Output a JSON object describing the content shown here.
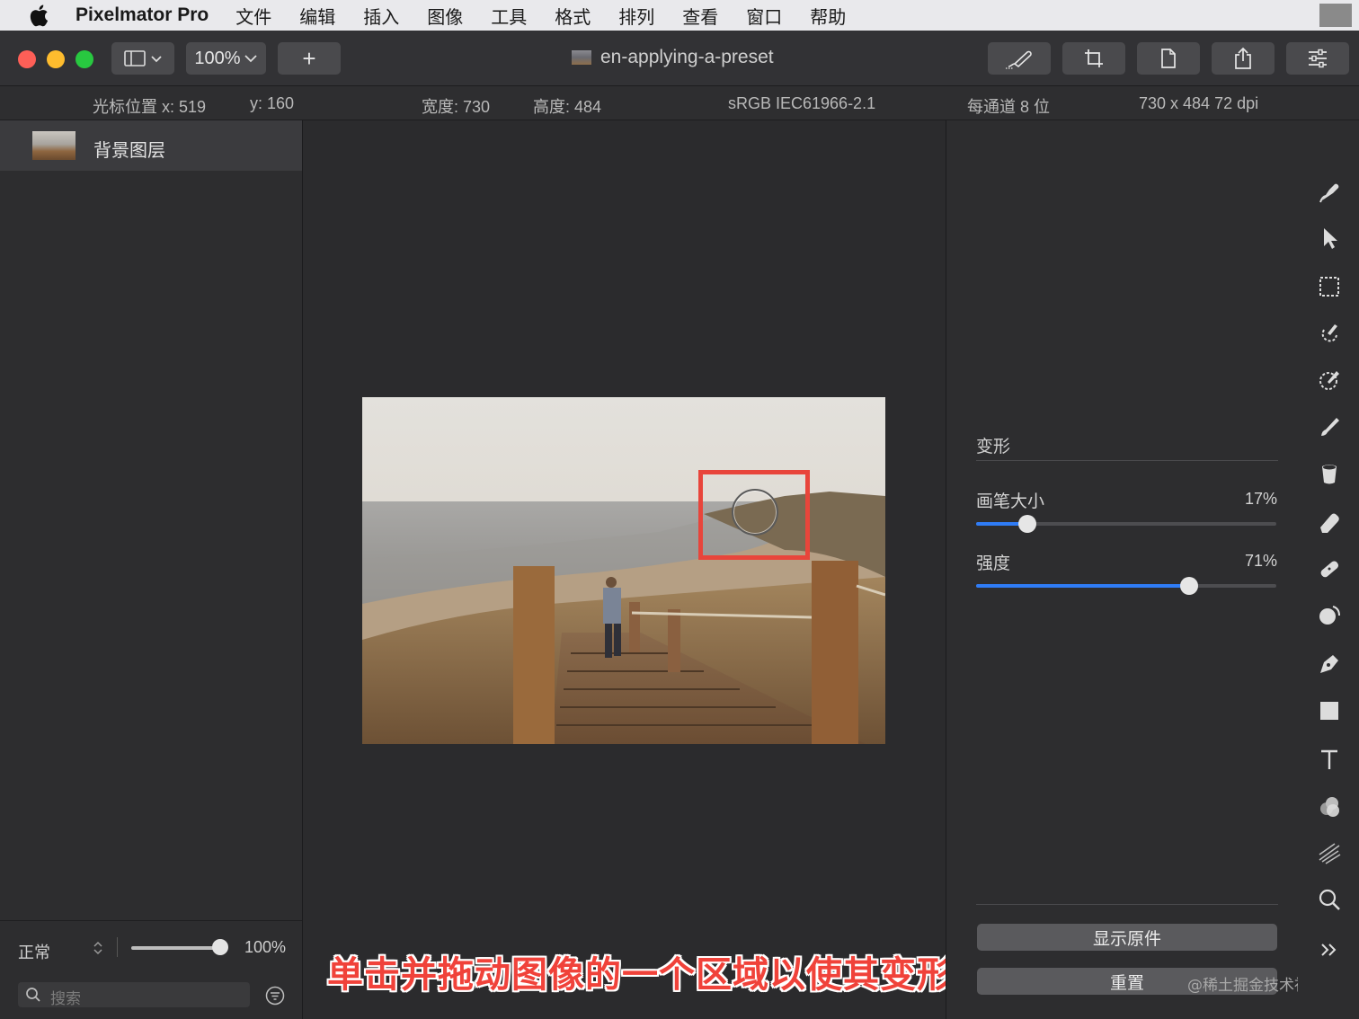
{
  "menubar": {
    "app_name": "Pixelmator Pro",
    "items": [
      "文件",
      "编辑",
      "插入",
      "图像",
      "工具",
      "格式",
      "排列",
      "查看",
      "窗口",
      "帮助"
    ]
  },
  "toolbar": {
    "zoom_label": "100%",
    "add_label": "+",
    "document_title": "en-applying-a-preset"
  },
  "infobar": {
    "cursor_x": "光标位置 x:  519",
    "cursor_y": "y:  160",
    "width": "宽度:  730",
    "height": "高度:  484",
    "color_profile": "sRGB IEC61966-2.1",
    "bit_depth": "每通道 8 位",
    "image_size": "730 x 484 72 dpi"
  },
  "layers": {
    "items": [
      {
        "name": "背景图层"
      }
    ],
    "blend_mode": "正常",
    "opacity_label": "100%",
    "opacity": 1.0,
    "search_placeholder": "搜索"
  },
  "canvas": {
    "caption": "单击并拖动图像的一个区域以使其变形"
  },
  "panel": {
    "title": "变形",
    "brush_size_label": "画笔大小",
    "brush_size_value": "17%",
    "brush_size": 0.17,
    "strength_label": "强度",
    "strength_value": "71%",
    "strength": 0.71,
    "show_original_label": "显示原件",
    "reset_label": "重置",
    "watermark": "@稀土掘金技术社区"
  },
  "colors": {
    "accent": "#2f7cf6",
    "highlight": "#e8453b",
    "close": "#fe5f57",
    "minimize": "#febc2e",
    "maximize": "#28c840"
  },
  "tools": [
    "warp-brush-icon",
    "arrange-icon",
    "rect-select-icon",
    "quick-select-icon",
    "color-select-icon",
    "paint-icon",
    "paint-bucket-icon",
    "erase-icon",
    "repair-icon",
    "clone-icon",
    "pen-icon",
    "shape-icon",
    "type-icon",
    "color-adjust-icon",
    "effects-icon",
    "zoom-icon",
    "more-tools-icon"
  ]
}
